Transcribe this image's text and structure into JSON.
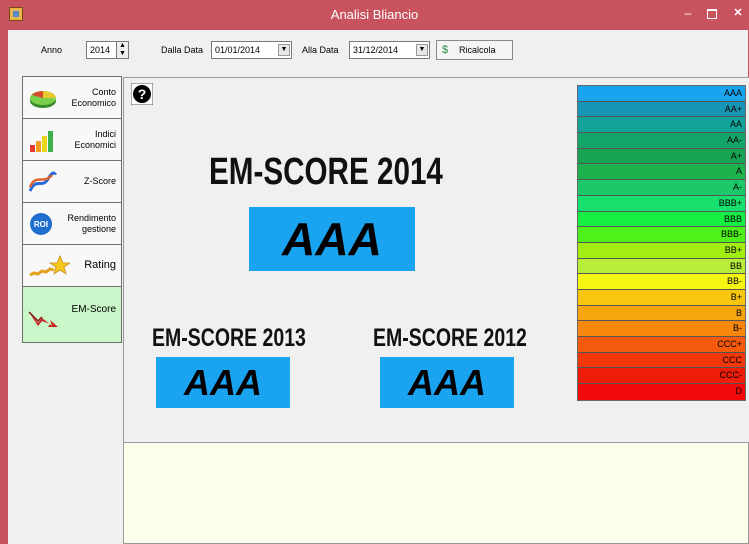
{
  "window": {
    "title": "Analisi Bliancio",
    "minimize": "–",
    "maximize": "",
    "close": "✕"
  },
  "toolbar": {
    "anno_label": "Anno",
    "anno_value": "2014",
    "dalla_data_label": "Dalla Data",
    "dalla_data_value": "01/01/2014",
    "alla_data_label": "Alla Data",
    "alla_data_value": "31/12/2014",
    "ricalcola_label": "Ricalcola"
  },
  "sidebar": {
    "items": [
      {
        "label": "Conto\nEconomico",
        "icon": "pie-chart-icon"
      },
      {
        "label": "Indici\nEconomici",
        "icon": "bar-chart-icon"
      },
      {
        "label": "Z-Score",
        "icon": "z-score-chart-icon"
      },
      {
        "label": "Rendimento\ngestione",
        "icon": "roi-icon"
      },
      {
        "label": "Rating",
        "icon": "rating-star-icon"
      },
      {
        "label": "EM-Score",
        "icon": "em-score-icon"
      }
    ],
    "active_index": 5
  },
  "main": {
    "help_icon": "help-icon",
    "score_main": {
      "title": "EM-SCORE  2014",
      "value": "AAA"
    },
    "score_2013": {
      "title": "EM-SCORE  2013",
      "value": "AAA"
    },
    "score_2012": {
      "title": "EM-SCORE  2012",
      "value": "AAA"
    }
  },
  "legend": [
    {
      "label": "AAA",
      "color": "#1aa3ee"
    },
    {
      "label": "AA+",
      "color": "#1696b4"
    },
    {
      "label": "AA",
      "color": "#12a39a"
    },
    {
      "label": "AA-",
      "color": "#14a56a"
    },
    {
      "label": "A+",
      "color": "#17a554"
    },
    {
      "label": "A",
      "color": "#1cb34e"
    },
    {
      "label": "A-",
      "color": "#1dc86a"
    },
    {
      "label": "BBB+",
      "color": "#18e06e"
    },
    {
      "label": "BBB",
      "color": "#16ee44"
    },
    {
      "label": "BBB-",
      "color": "#4cf21a"
    },
    {
      "label": "BB+",
      "color": "#a2ee12"
    },
    {
      "label": "BB",
      "color": "#b8ee3a"
    },
    {
      "label": "BB-",
      "color": "#f5f511"
    },
    {
      "label": "B+",
      "color": "#f8c60e"
    },
    {
      "label": "B",
      "color": "#f7a50d"
    },
    {
      "label": "B-",
      "color": "#f7860c"
    },
    {
      "label": "CCC+",
      "color": "#f4590c"
    },
    {
      "label": "CCC",
      "color": "#f2370b"
    },
    {
      "label": "CCC-",
      "color": "#ee1d0a"
    },
    {
      "label": "D",
      "color": "#f10a0a"
    }
  ]
}
